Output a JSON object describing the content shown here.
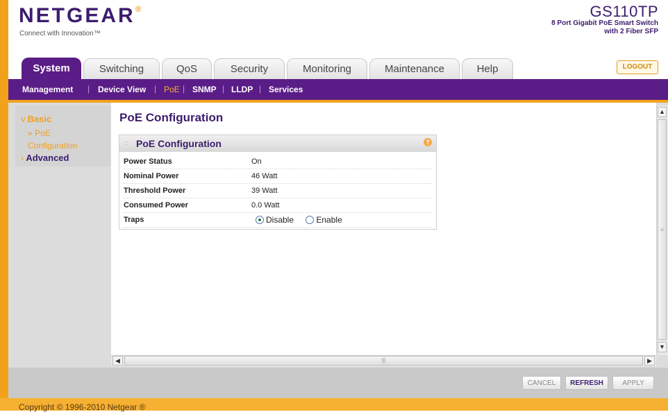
{
  "header": {
    "logo": "NETGEAR",
    "logo_mark": "®",
    "tagline": "Connect with Innovation™",
    "model_name": "GS110TP",
    "model_desc_1": "8 Port Gigabit PoE Smart Switch",
    "model_desc_2": "with 2 Fiber SFP"
  },
  "tabs": [
    {
      "label": "System",
      "active": true
    },
    {
      "label": "Switching",
      "active": false
    },
    {
      "label": "QoS",
      "active": false
    },
    {
      "label": "Security",
      "active": false
    },
    {
      "label": "Monitoring",
      "active": false
    },
    {
      "label": "Maintenance",
      "active": false
    },
    {
      "label": "Help",
      "active": false
    }
  ],
  "logout_label": "LOGOUT",
  "subnav": [
    {
      "label": "Management",
      "active": false
    },
    {
      "label": "Device View",
      "active": false
    },
    {
      "label": "PoE",
      "active": true
    },
    {
      "label": "SNMP",
      "active": false
    },
    {
      "label": "LLDP",
      "active": false
    },
    {
      "label": "Services",
      "active": false
    }
  ],
  "leftnav": {
    "basic_label": "Basic",
    "poe_line1": "PoE",
    "poe_line2": "Configuration",
    "advanced_label": "Advanced"
  },
  "page_title": "PoE Configuration",
  "panel": {
    "title": "PoE Configuration",
    "help_icon": "?",
    "rows": [
      {
        "label": "Power Status",
        "value": "On"
      },
      {
        "label": "Nominal Power",
        "value": "46 Watt"
      },
      {
        "label": "Threshold Power",
        "value": "39 Watt"
      },
      {
        "label": "Consumed Power",
        "value": "0.0 Watt"
      }
    ],
    "traps": {
      "label": "Traps",
      "options": [
        "Disable",
        "Enable"
      ],
      "selected": "Disable"
    }
  },
  "actions": {
    "cancel": "CANCEL",
    "refresh": "REFRESH",
    "apply": "APPLY"
  },
  "footer": {
    "copyright": "Copyright © 1996-2010 Netgear ®"
  },
  "colors": {
    "brand_purple": "#5a1d87",
    "accent_orange": "#f2a21a"
  }
}
